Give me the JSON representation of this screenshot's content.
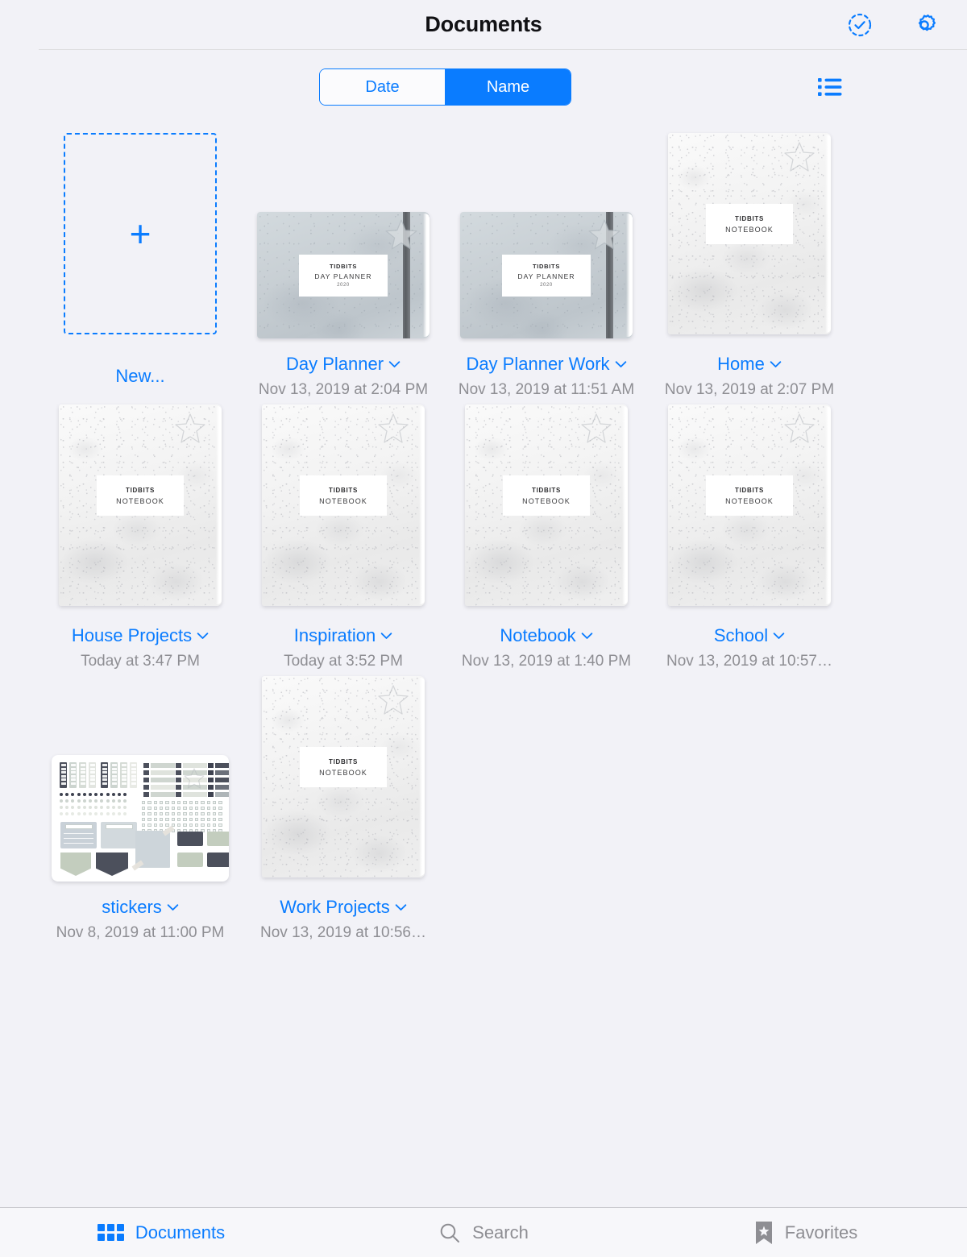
{
  "header": {
    "title": "Documents",
    "select_icon": "check-circle-dashed-icon",
    "settings_icon": "gear-icon"
  },
  "toolbar": {
    "sort_options": [
      {
        "label": "Date",
        "selected": false
      },
      {
        "label": "Name",
        "selected": true
      }
    ],
    "view_toggle_icon": "list-view-icon"
  },
  "new_item": {
    "label": "New...",
    "plus_icon": "plus-icon"
  },
  "cover_text": {
    "brand": "TIDBITS",
    "notebook": "NOTEBOOK",
    "day_planner": "DAY PLANNER",
    "year": "2020"
  },
  "documents": [
    {
      "name": "Day Planner",
      "date": "Nov 13, 2019 at 2:04 PM",
      "thumb": "day-planner"
    },
    {
      "name": "Day Planner Work",
      "date": "Nov 13, 2019 at 11:51 AM",
      "thumb": "day-planner"
    },
    {
      "name": "Home",
      "date": "Nov 13, 2019 at 2:07 PM",
      "thumb": "notebook"
    },
    {
      "name": "House Projects",
      "date": "Today at 3:47 PM",
      "thumb": "notebook"
    },
    {
      "name": "Inspiration",
      "date": "Today at 3:52 PM",
      "thumb": "notebook"
    },
    {
      "name": "Notebook",
      "date": "Nov 13, 2019 at 1:40 PM",
      "thumb": "notebook"
    },
    {
      "name": "School",
      "date": "Nov 13, 2019 at 10:57…",
      "thumb": "notebook"
    },
    {
      "name": "stickers",
      "date": "Nov 8, 2019 at 11:00 PM",
      "thumb": "stickers"
    },
    {
      "name": "Work Projects",
      "date": "Nov 13, 2019 at 10:56…",
      "thumb": "notebook"
    }
  ],
  "tabs": [
    {
      "label": "Documents",
      "icon": "grid-icon",
      "active": true
    },
    {
      "label": "Search",
      "icon": "search-icon",
      "active": false
    },
    {
      "label": "Favorites",
      "icon": "bookmark-star-icon",
      "active": false
    }
  ],
  "colors": {
    "accent": "#0a7cff",
    "background": "#f2f2f7",
    "secondary_text": "#8e8e93",
    "title_text": "#111114"
  }
}
